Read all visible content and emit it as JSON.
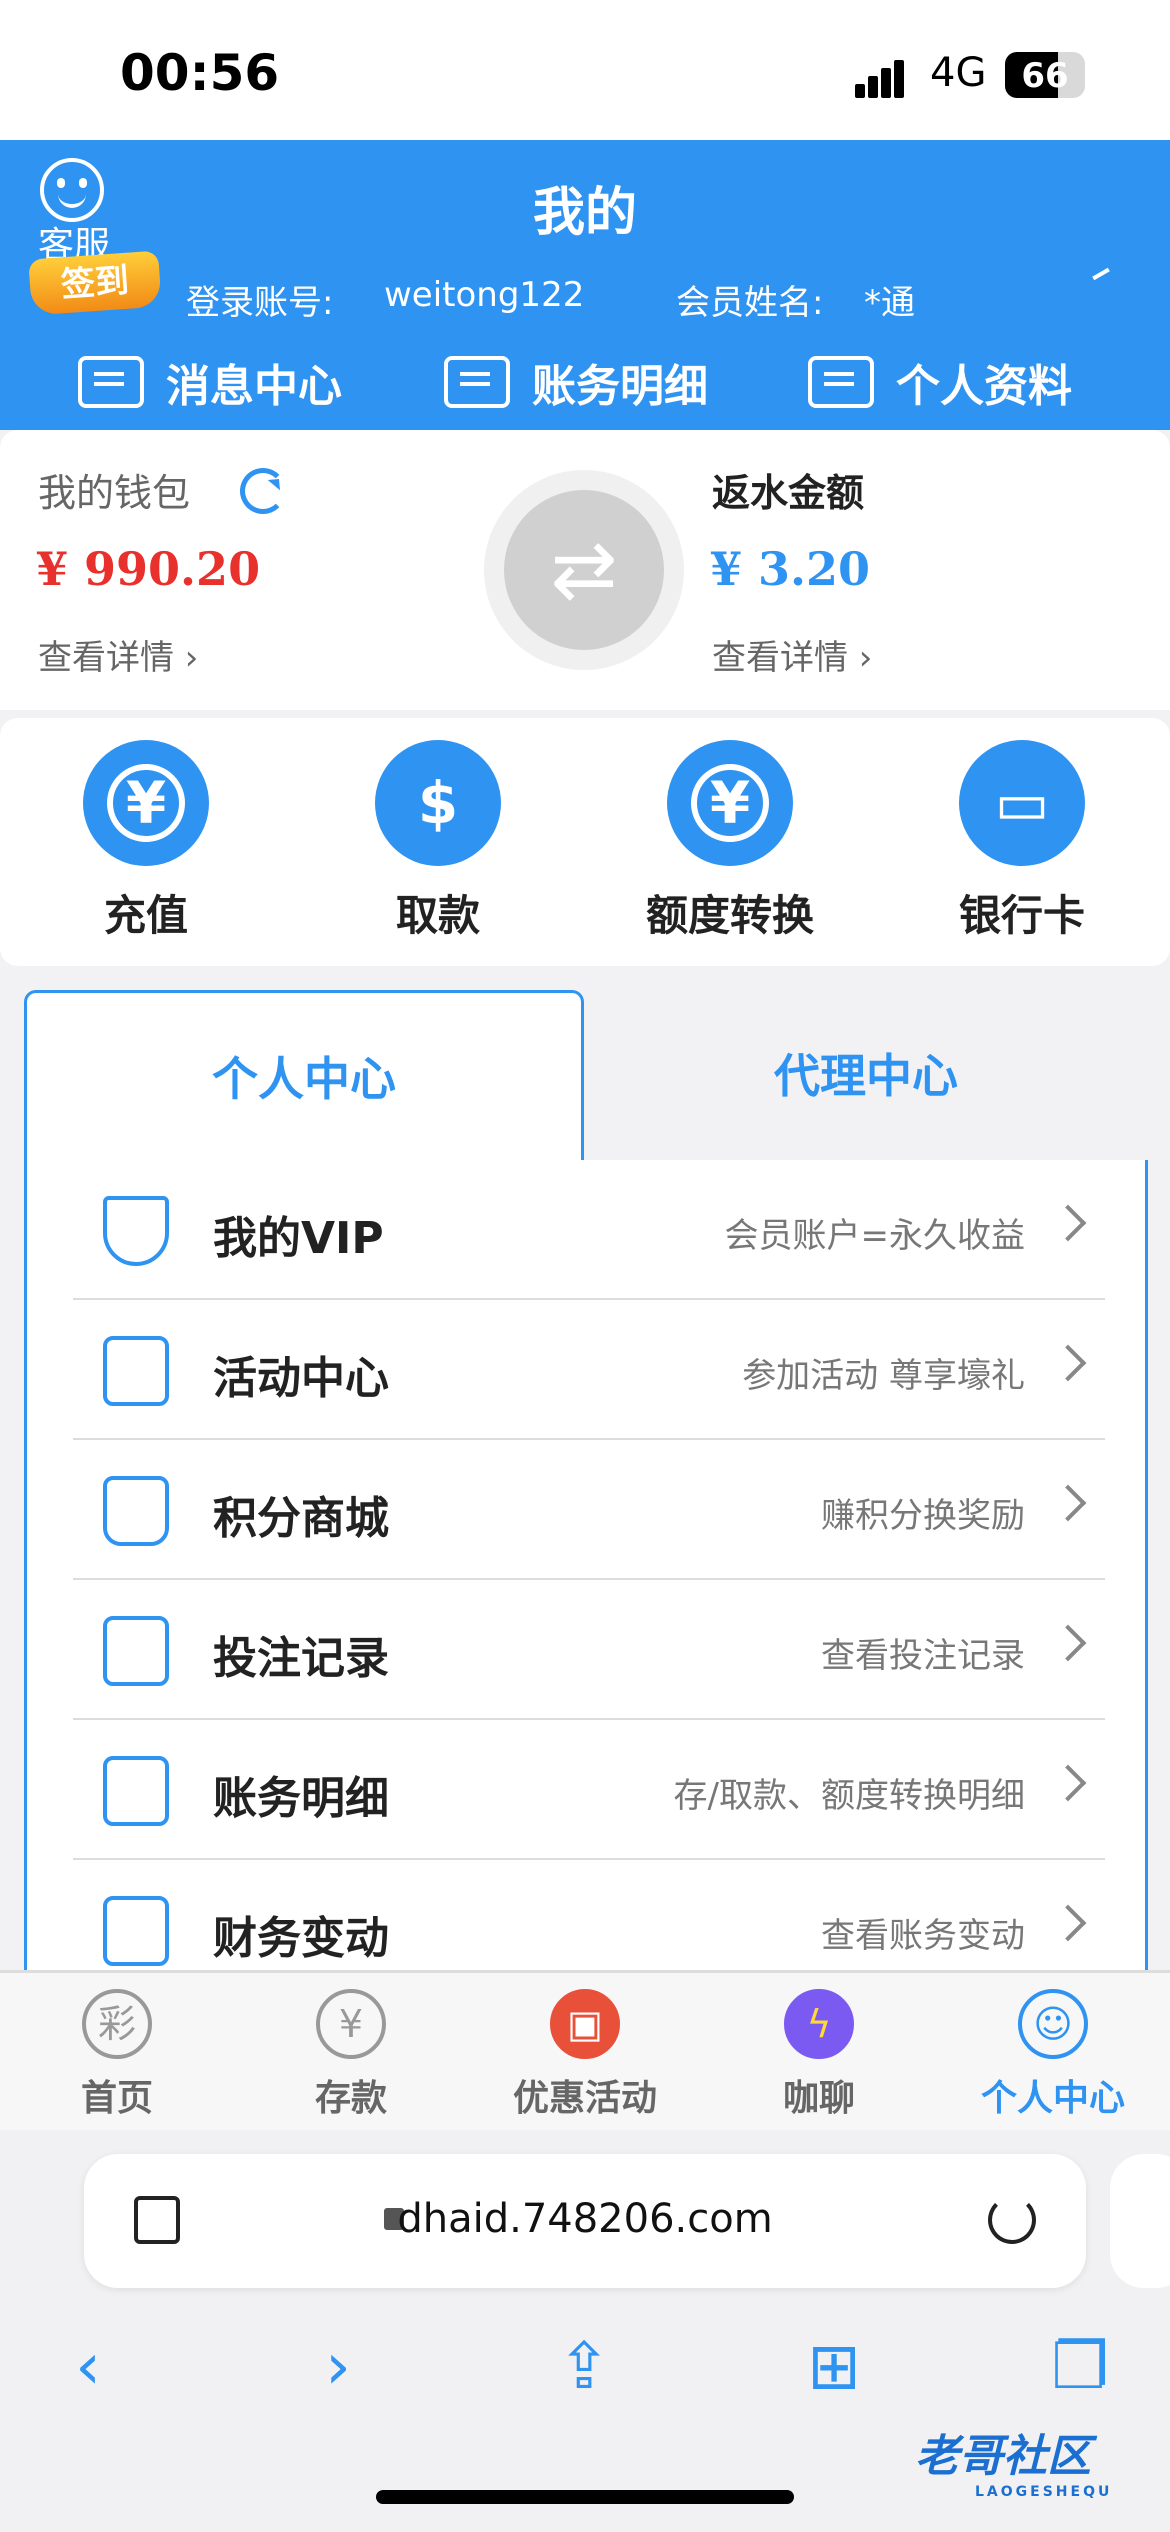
{
  "status_bar": {
    "time": "00:56",
    "network": "4G",
    "battery": "66",
    "battery_level": 0.66
  },
  "header": {
    "customer_service": "客服",
    "title": "我的",
    "sign_badge": "签到",
    "account_label": "登录账号:",
    "account_value": "weitong122",
    "member_label": "会员姓名:",
    "member_value": "*通",
    "nav": [
      "消息中心",
      "账务明细",
      "个人资料"
    ]
  },
  "wallet": {
    "title": "我的钱包",
    "amount": "¥ 990.20",
    "detail": "查看详情",
    "rebate_title": "返水金额",
    "rebate_amount": "¥ 3.20",
    "rebate_detail": "查看详情"
  },
  "quick_actions": [
    {
      "label": "充值",
      "icon": "yuan-icon"
    },
    {
      "label": "取款",
      "icon": "withdraw-icon"
    },
    {
      "label": "额度转换",
      "icon": "transfer-icon"
    },
    {
      "label": "银行卡",
      "icon": "bank-card-icon"
    }
  ],
  "tabs": {
    "personal": "个人中心",
    "agent": "代理中心"
  },
  "menu": [
    {
      "title": "我的VIP",
      "subtitle": "会员账户=永久收益"
    },
    {
      "title": "活动中心",
      "subtitle": "参加活动 尊享壕礼"
    },
    {
      "title": "积分商城",
      "subtitle": "赚积分换奖励"
    },
    {
      "title": "投注记录",
      "subtitle": "查看投注记录"
    },
    {
      "title": "账务明细",
      "subtitle": "存/取款、额度转换明细"
    },
    {
      "title": "财务变动",
      "subtitle": "查看账务变动"
    }
  ],
  "bottom_nav": [
    "首页",
    "存款",
    "优惠活动",
    "咖聊",
    "个人中心"
  ],
  "browser": {
    "url": "dhaid.748206.com"
  },
  "watermark": {
    "text": "老哥社区",
    "sub": "LAOGESHEQU"
  },
  "colors": {
    "brand": "#2f93f2",
    "amount_red": "#e8302d"
  }
}
